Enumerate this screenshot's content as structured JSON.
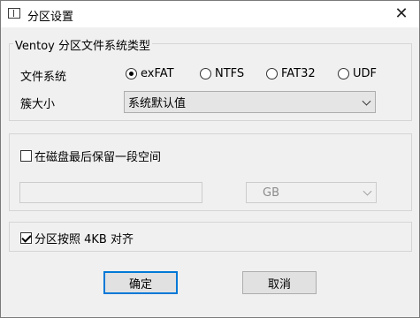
{
  "window": {
    "title": "分区设置",
    "close_symbol": "✕",
    "icon": "window-icon"
  },
  "partition_type": {
    "legend": "Ventoy 分区文件系统类型",
    "fs_label": "文件系统",
    "fs_options": [
      {
        "label": "exFAT",
        "checked": true
      },
      {
        "label": "NTFS",
        "checked": false
      },
      {
        "label": "FAT32",
        "checked": false
      },
      {
        "label": "UDF",
        "checked": false
      }
    ],
    "cluster_label": "簇大小",
    "cluster_value": "系统默认值"
  },
  "reserve": {
    "checkbox_label": "在磁盘最后保留一段空间",
    "checked": false,
    "size_value": "",
    "unit_value": "GB"
  },
  "align": {
    "checkbox_label": "分区按照 4KB 对齐",
    "checked": true
  },
  "buttons": {
    "ok": "确定",
    "cancel": "取消"
  },
  "colors": {
    "accent": "#0078d7",
    "window_bg": "#f0f0f0",
    "titlebar_bg": "#ffffff"
  }
}
